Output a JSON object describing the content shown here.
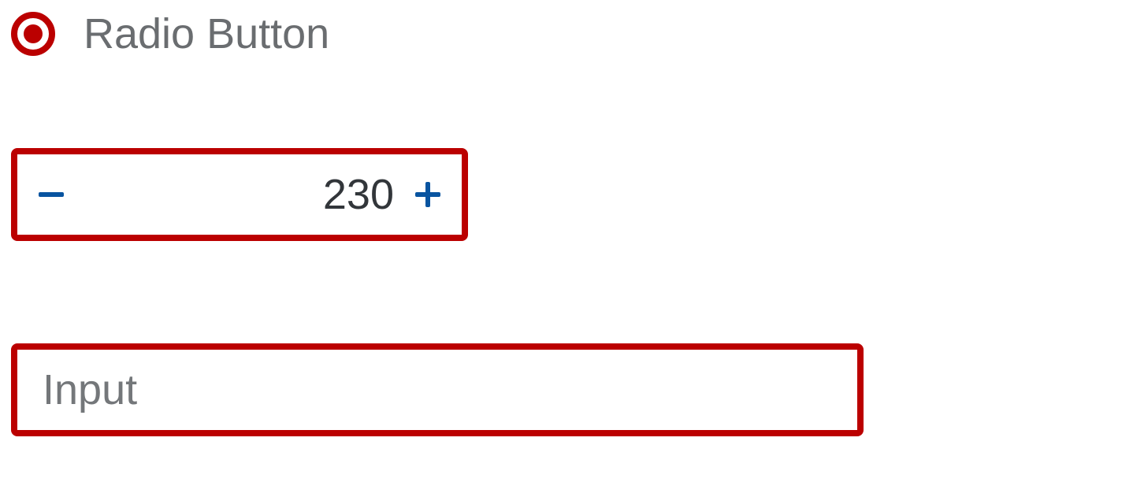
{
  "colors": {
    "error_border": "#bb0000",
    "icon_blue": "#0854a0",
    "label_gray": "#6a6d70",
    "text_dark": "#32363a"
  },
  "radio": {
    "label": "Radio Button",
    "selected": true
  },
  "stepper": {
    "value": "230",
    "minus_icon": "minus",
    "plus_icon": "plus"
  },
  "input": {
    "value": "",
    "placeholder": "Input"
  }
}
